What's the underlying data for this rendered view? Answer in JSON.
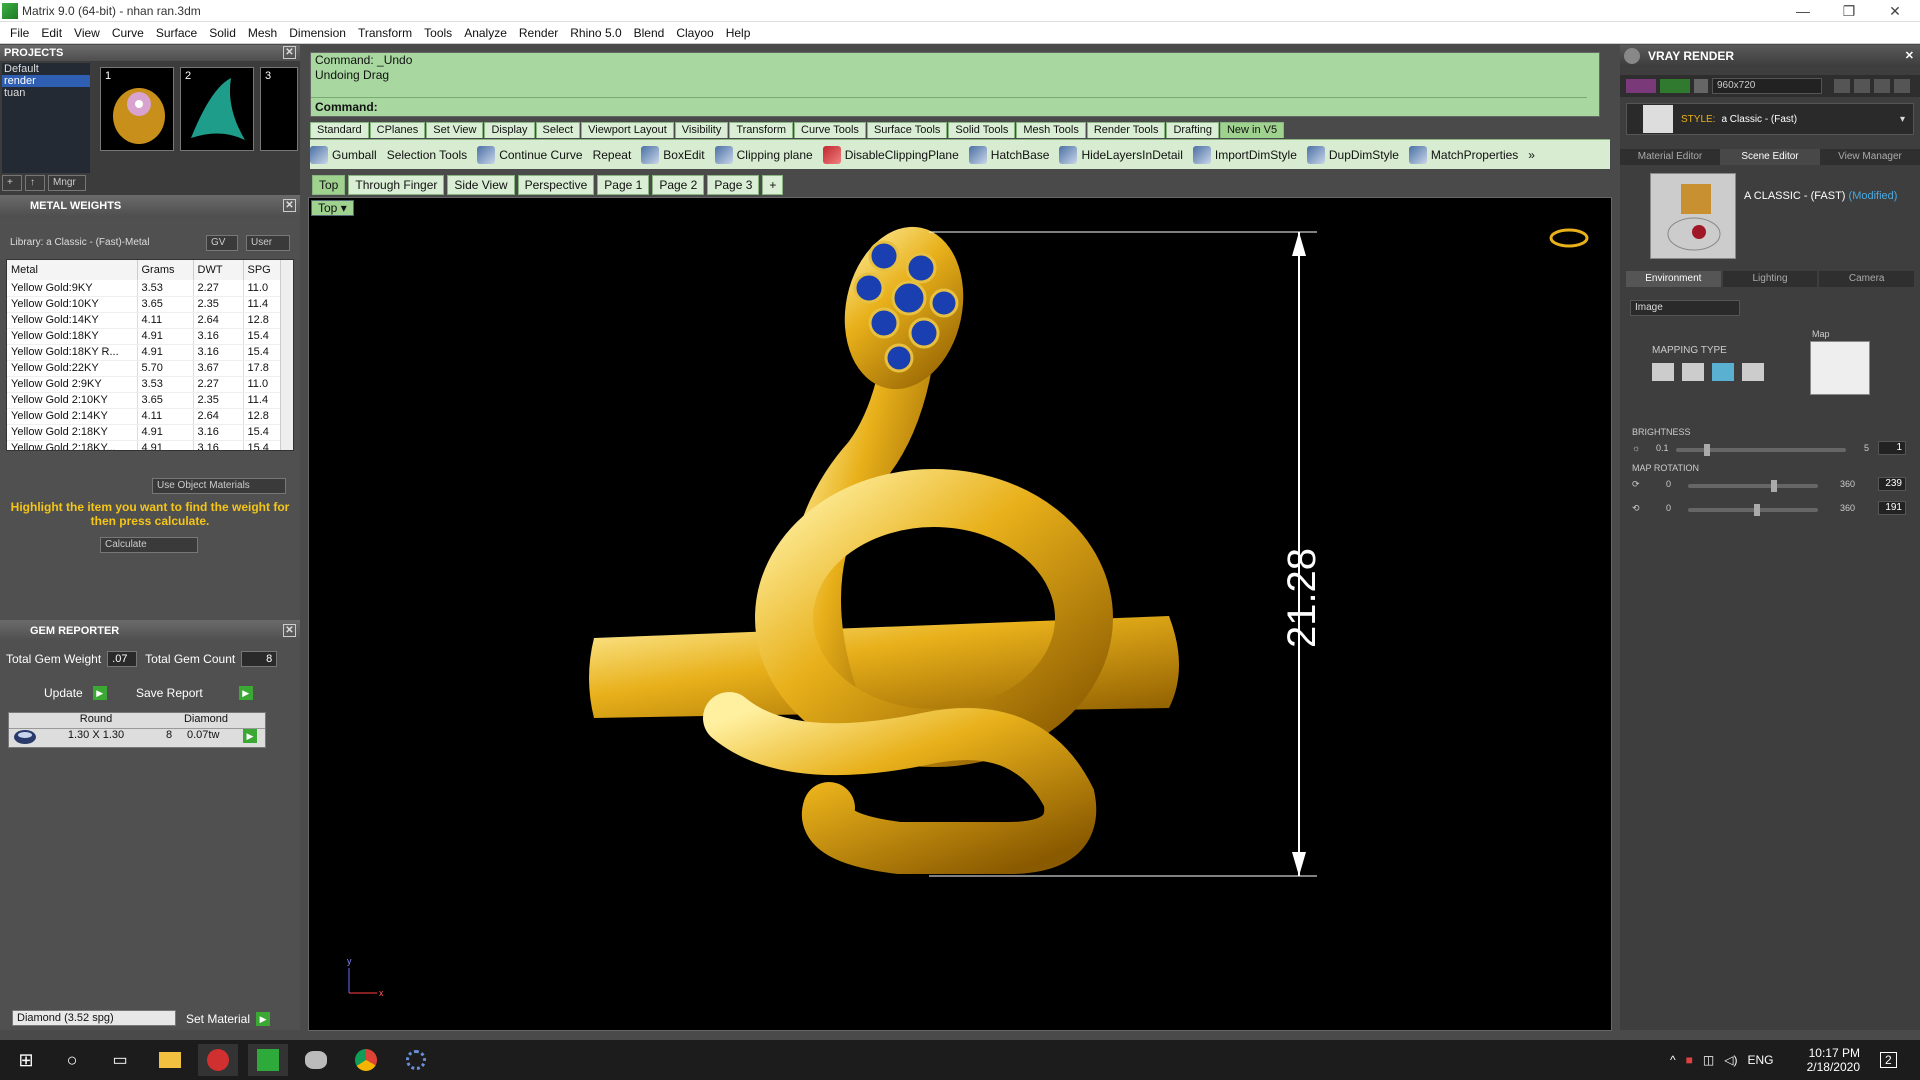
{
  "window": {
    "title": "Matrix 9.0 (64-bit) - nhan ran.3dm",
    "controls": [
      "—",
      "❐",
      "✕"
    ]
  },
  "menu": [
    "File",
    "Edit",
    "View",
    "Curve",
    "Surface",
    "Solid",
    "Mesh",
    "Dimension",
    "Transform",
    "Tools",
    "Analyze",
    "Render",
    "Rhino 5.0",
    "Blend",
    "Clayoo",
    "Help"
  ],
  "projects": {
    "title": "PROJECTS",
    "items": [
      "Default",
      "render",
      "tuan"
    ],
    "selected": "render",
    "thumbs": [
      "1",
      "2",
      "3"
    ],
    "mgr_label": "Mngr"
  },
  "metal_weights": {
    "title": "METAL WEIGHTS",
    "library": "Library: a Classic - (Fast)-Metal",
    "gv_label": "GV",
    "user_label": "User",
    "columns": [
      "Metal",
      "Grams",
      "DWT",
      "SPG"
    ],
    "rows": [
      [
        "Yellow Gold:9KY",
        "3.53",
        "2.27",
        "11.0"
      ],
      [
        "Yellow Gold:10KY",
        "3.65",
        "2.35",
        "11.4"
      ],
      [
        "Yellow Gold:14KY",
        "4.11",
        "2.64",
        "12.8"
      ],
      [
        "Yellow Gold:18KY",
        "4.91",
        "3.16",
        "15.4"
      ],
      [
        "Yellow Gold:18KY R...",
        "4.91",
        "3.16",
        "15.4"
      ],
      [
        "Yellow Gold:22KY",
        "5.70",
        "3.67",
        "17.8"
      ],
      [
        "Yellow Gold 2:9KY",
        "3.53",
        "2.27",
        "11.0"
      ],
      [
        "Yellow Gold 2:10KY",
        "3.65",
        "2.35",
        "11.4"
      ],
      [
        "Yellow Gold 2:14KY",
        "4.11",
        "2.64",
        "12.8"
      ],
      [
        "Yellow Gold 2:18KY",
        "4.91",
        "3.16",
        "15.4"
      ],
      [
        "Yellow Gold 2:18KY...",
        "4.91",
        "3.16",
        "15.4"
      ]
    ],
    "use_object_materials": "Use Object Materials",
    "hint": "Highlight the item you want to find the weight for then press calculate.",
    "calculate": "Calculate"
  },
  "gem_reporter": {
    "title": "GEM REPORTER",
    "total_weight_label": "Total Gem Weight",
    "total_weight": ".07",
    "total_count_label": "Total Gem Count",
    "total_count": "8",
    "update": "Update",
    "save_report": "Save Report",
    "table_headers": [
      "Round",
      "Diamond"
    ],
    "row": {
      "size": "1.30 X 1.30",
      "count": "8",
      "weight": "0.07tw"
    },
    "material": "Diamond     (3.52 spg)",
    "set_material": "Set Material"
  },
  "command": {
    "line1": "Command: _Undo",
    "line2": "Undoing Drag",
    "prompt": "Command:"
  },
  "toolbar_tabs": [
    "Standard",
    "CPlanes",
    "Set View",
    "Display",
    "Select",
    "Viewport Layout",
    "Visibility",
    "Transform",
    "Curve Tools",
    "Surface Tools",
    "Solid Tools",
    "Mesh Tools",
    "Render Tools",
    "Drafting",
    "New in V5"
  ],
  "active_toolbar_tab": "New in V5",
  "tools": [
    "Gumball",
    "Selection Tools",
    "Continue Curve",
    "Repeat",
    "BoxEdit",
    "Clipping plane",
    "DisableClippingPlane",
    "HatchBase",
    "HideLayersInDetail",
    "ImportDimStyle",
    "DupDimStyle",
    "MatchProperties",
    "»"
  ],
  "view_tabs": [
    "Top",
    "Through Finger",
    "Side View",
    "Perspective",
    "Page 1",
    "Page 2",
    "Page 3",
    "+"
  ],
  "active_view": "Top",
  "viewport": {
    "label": "Top",
    "dimension": "21.28",
    "axis_x": "x",
    "axis_y": "y"
  },
  "vray": {
    "title": "VRAY RENDER",
    "resolution": "960x720",
    "style_label": "STYLE:",
    "style_value": "a Classic - (Fast)",
    "subtabs": [
      "Material Editor",
      "Scene Editor",
      "View Manager"
    ],
    "active_subtab": "Scene Editor",
    "scene_name": "A CLASSIC - (FAST)",
    "scene_modified": "(Modified)",
    "env_tabs": [
      "Environment",
      "Lighting",
      "Camera"
    ],
    "active_env_tab": "Environment",
    "env_type": "Image",
    "map_label": "Map",
    "mapping_type": "MAPPING TYPE",
    "brightness_label": "BRIGHTNESS",
    "brightness_min": "0.1",
    "brightness_max": "5",
    "brightness_value": "1",
    "brightness_level": 0.18,
    "map_rotation_label": "MAP ROTATION",
    "rot1": {
      "min": "0",
      "max": "360",
      "value": "239",
      "level": 0.66
    },
    "rot2": {
      "min": "0",
      "max": "360",
      "value": "191",
      "level": 0.53
    }
  },
  "taskbar": {
    "lang": "ENG",
    "time": "10:17 PM",
    "date": "2/18/2020",
    "notifications": "2"
  },
  "colors": {
    "gold": "#e8b01a",
    "sapphire": "#1a3fb0",
    "cmd_green": "#a8d8a0",
    "tab_green": "#9fd18f"
  }
}
